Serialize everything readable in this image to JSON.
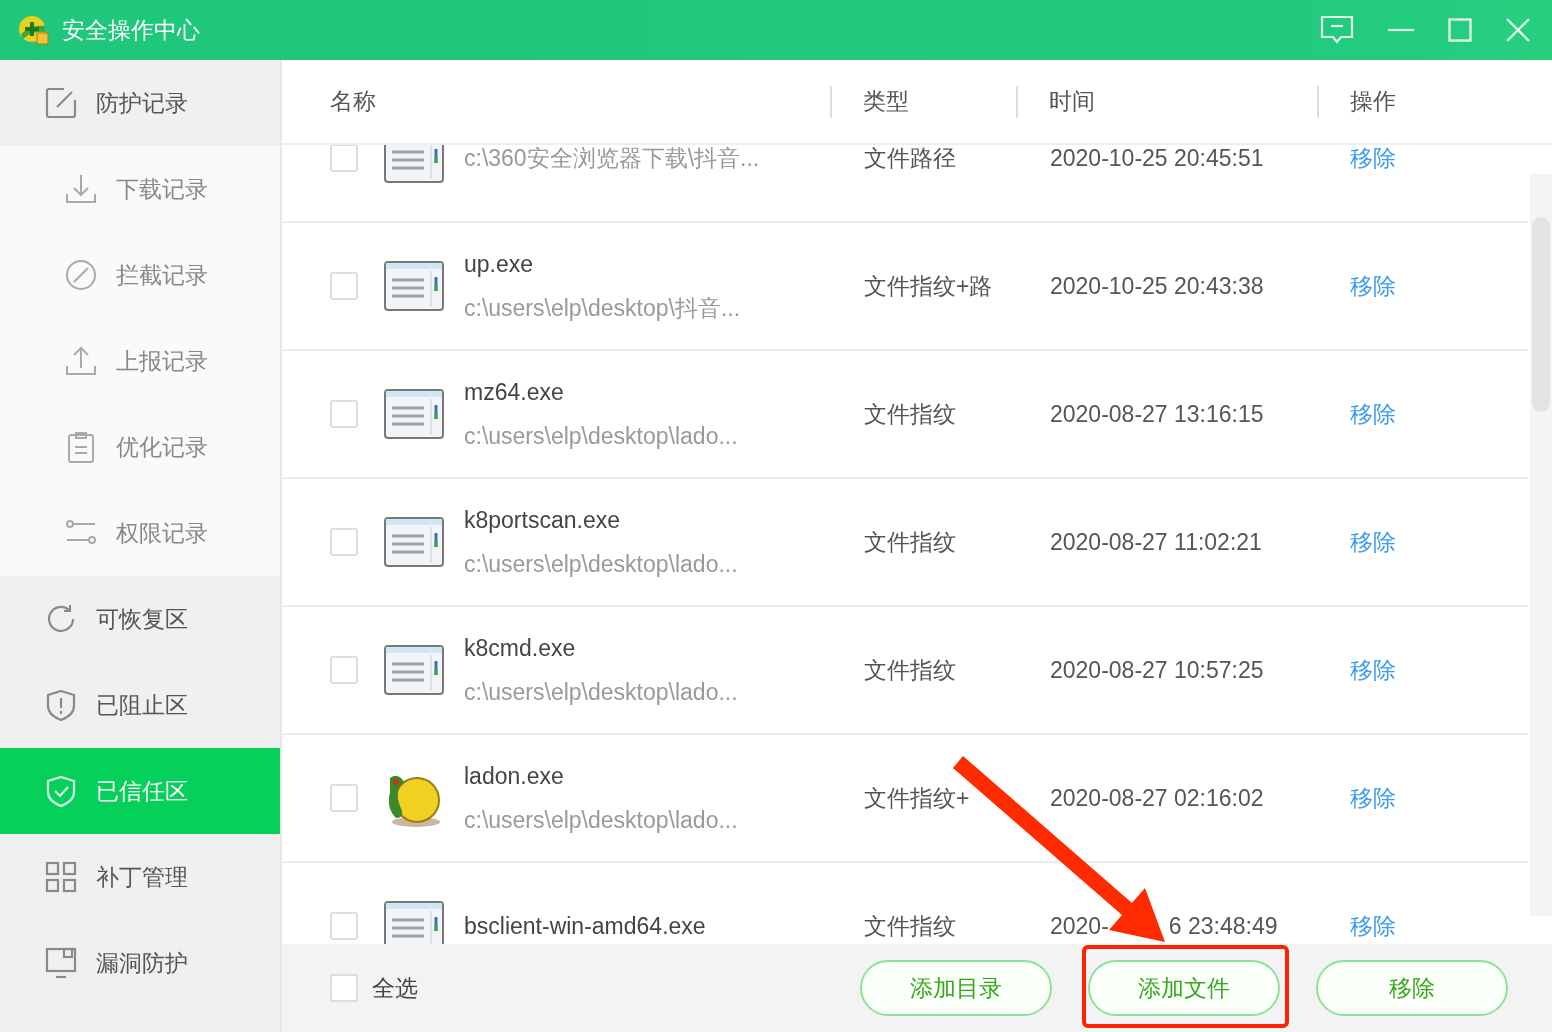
{
  "window": {
    "title": "安全操作中心"
  },
  "sidebar": {
    "items": [
      {
        "label": "防护记录",
        "expanded": true,
        "selected": false,
        "children": [
          {
            "label": "下载记录",
            "selected": false
          },
          {
            "label": "拦截记录",
            "selected": false
          },
          {
            "label": "上报记录",
            "selected": false
          },
          {
            "label": "优化记录",
            "selected": false
          },
          {
            "label": "权限记录",
            "selected": false
          }
        ]
      },
      {
        "label": "可恢复区",
        "selected": false
      },
      {
        "label": "已阻止区",
        "selected": false
      },
      {
        "label": "已信任区",
        "selected": true
      },
      {
        "label": "补丁管理",
        "selected": false
      },
      {
        "label": "漏洞防护",
        "selected": false
      }
    ]
  },
  "table": {
    "columns": [
      "名称",
      "类型",
      "时间",
      "操作"
    ],
    "rows": [
      {
        "kind": "file",
        "checked": false,
        "path": "c:\\360安全浏览器下载\\抖音...",
        "type": "文件路径",
        "time": "2020-10-25 20:45:51",
        "action": "移除"
      },
      {
        "kind": "file",
        "checked": false,
        "name": "up.exe",
        "path": "c:\\users\\elp\\desktop\\抖音...",
        "type": "文件指纹+路",
        "time": "2020-10-25 20:43:38",
        "action": "移除"
      },
      {
        "kind": "file",
        "checked": false,
        "name": "mz64.exe",
        "path": "c:\\users\\elp\\desktop\\lado...",
        "type": "文件指纹",
        "time": "2020-08-27 13:16:15",
        "action": "移除"
      },
      {
        "kind": "file",
        "checked": false,
        "name": "k8portscan.exe",
        "path": "c:\\users\\elp\\desktop\\lado...",
        "type": "文件指纹",
        "time": "2020-08-27 11:02:21",
        "action": "移除"
      },
      {
        "kind": "file",
        "checked": false,
        "name": "k8cmd.exe",
        "path": "c:\\users\\elp\\desktop\\lado...",
        "type": "文件指纹",
        "time": "2020-08-27 10:57:25",
        "action": "移除"
      },
      {
        "kind": "emblem",
        "checked": false,
        "name": "ladon.exe",
        "path": "c:\\users\\elp\\desktop\\lado...",
        "type": "文件指纹+",
        "time": "2020-08-27 02:16:02",
        "action": "移除"
      },
      {
        "kind": "file",
        "checked": false,
        "name": "bsclient-win-amd64.exe",
        "type": "文件指纹",
        "time": "2020-",
        "time_after_cover": "6 23:48:49",
        "action": "移除"
      }
    ]
  },
  "footer": {
    "select_all": {
      "label": "全选",
      "checked": false
    },
    "buttons": [
      "添加目录",
      "添加文件",
      "移除"
    ]
  }
}
